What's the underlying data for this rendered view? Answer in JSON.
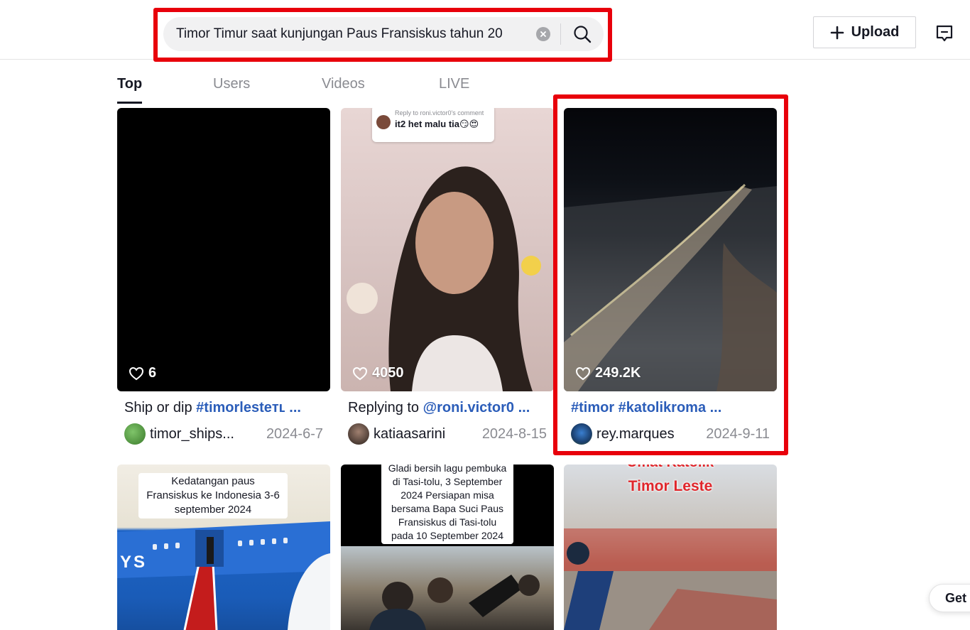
{
  "search": {
    "query": "Timor Timur saat kunjungan Paus Fransiskus tahun 20",
    "clear_icon": "clear-circle-icon",
    "search_icon": "search-icon"
  },
  "header": {
    "upload_label": "Upload",
    "inbox_icon": "inbox-message-icon"
  },
  "tabs": [
    "Top",
    "Users",
    "Videos",
    "LIVE"
  ],
  "cards": [
    {
      "likes": "6",
      "caption_text": "Ship or dip ",
      "caption_tag": "#timorlesteтʟ ...",
      "author": "timor_ships...",
      "date": "2024-6-7"
    },
    {
      "likes": "4050",
      "reply_small": "Reply to roni.victor0's comment",
      "reply_text": "it2 het malu tia😏😍",
      "caption_text": "Replying to ",
      "caption_tag": "@roni.victor0 ...",
      "author": "katiaasarini",
      "date": "2024-8-15"
    },
    {
      "likes": "249.2K",
      "caption_text": "",
      "caption_tag": "#timor #katolikroma ...",
      "author": "rey.marques",
      "date": "2024-9-11"
    },
    {
      "overlay": "Kedatangan paus Fransiskus ke Indonesia 3-6 september 2024",
      "plane_text": "YS"
    },
    {
      "overlay": "Gladi bersih lagu pembuka di Tasi-tolu, 3 September 2024 Persiapan misa bersama Bapa Suci Paus Fransiskus di Tasi-tolu pada 10 September 2024"
    },
    {
      "overlay_top": "Umat Katolik",
      "overlay": "Timor Leste"
    }
  ],
  "get_app_label": "Get",
  "colors": {
    "highlight": "#e8000b",
    "tag": "#2b5db9",
    "muted": "#8a8b91"
  }
}
